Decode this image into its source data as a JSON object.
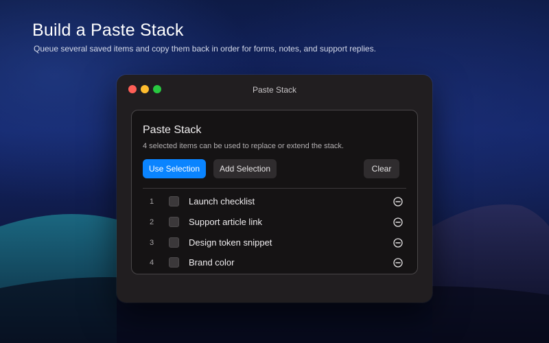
{
  "hero": {
    "title": "Build a Paste Stack",
    "subtitle": "Queue several saved items and copy them back in order for forms, notes, and support replies."
  },
  "window": {
    "title": "Paste Stack",
    "controls": [
      "close",
      "minimize",
      "zoom"
    ]
  },
  "panel": {
    "title": "Paste Stack",
    "description": "4 selected items can be used to replace or extend the stack.",
    "buttons": {
      "use_selection": "Use Selection",
      "add_selection": "Add Selection",
      "clear": "Clear"
    },
    "items": [
      {
        "index": "1",
        "label": "Launch checklist",
        "checked": false
      },
      {
        "index": "2",
        "label": "Support article link",
        "checked": false
      },
      {
        "index": "3",
        "label": "Design token snippet",
        "checked": false
      },
      {
        "index": "4",
        "label": "Brand color",
        "checked": false
      }
    ],
    "item_action_icon": "minus-circle-icon"
  },
  "colors": {
    "accent": "#0a84ff",
    "window_bg": "#211e20",
    "panel_bg": "#151314",
    "traffic_close": "#ff5f57",
    "traffic_minimize": "#febc2e",
    "traffic_zoom": "#28c840"
  }
}
